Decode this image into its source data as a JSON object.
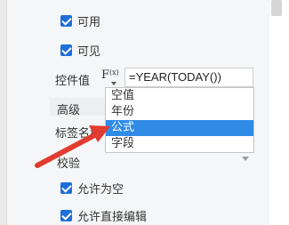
{
  "checkboxes": {
    "enabled": {
      "label": "可用",
      "checked": true
    },
    "visible": {
      "label": "可见",
      "checked": true
    },
    "allow_empty": {
      "label": "允许为空",
      "checked": true
    },
    "allow_direct_edit": {
      "label": "允许直接编辑",
      "checked": true
    }
  },
  "control_value": {
    "label": "控件值",
    "fx_label": "F",
    "fx_sub": "(x)",
    "formula": "=YEAR(TODAY())"
  },
  "dropdown": {
    "options": [
      "空值",
      "年份",
      "公式",
      "字段"
    ],
    "selected": "公式"
  },
  "sections": {
    "advanced": "高级",
    "tag_name": "标签名称",
    "validation": "校验"
  },
  "colors": {
    "accent": "#1e6fd9",
    "selection": "#2f8be6",
    "arrow": "#e23b2f"
  }
}
